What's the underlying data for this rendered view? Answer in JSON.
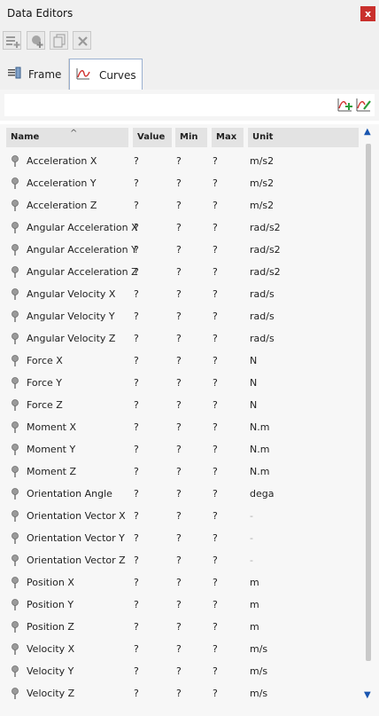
{
  "window": {
    "title": "Data Editors",
    "close_label": "x"
  },
  "tabs": [
    {
      "label": "Frame",
      "icon": "frame-icon",
      "active": false
    },
    {
      "label": "Curves",
      "icon": "curves-icon",
      "active": true
    }
  ],
  "table": {
    "columns": [
      "Name",
      "Value",
      "Min",
      "Max",
      "Unit"
    ],
    "rows": [
      {
        "name": "Acceleration X",
        "value": "?",
        "min": "?",
        "max": "?",
        "unit": "m/s2"
      },
      {
        "name": "Acceleration Y",
        "value": "?",
        "min": "?",
        "max": "?",
        "unit": "m/s2"
      },
      {
        "name": "Acceleration Z",
        "value": "?",
        "min": "?",
        "max": "?",
        "unit": "m/s2"
      },
      {
        "name": "Angular Acceleration X",
        "value": "?",
        "min": "?",
        "max": "?",
        "unit": "rad/s2"
      },
      {
        "name": "Angular Acceleration Y",
        "value": "?",
        "min": "?",
        "max": "?",
        "unit": "rad/s2"
      },
      {
        "name": "Angular Acceleration Z",
        "value": "?",
        "min": "?",
        "max": "?",
        "unit": "rad/s2"
      },
      {
        "name": "Angular Velocity X",
        "value": "?",
        "min": "?",
        "max": "?",
        "unit": "rad/s"
      },
      {
        "name": "Angular Velocity Y",
        "value": "?",
        "min": "?",
        "max": "?",
        "unit": "rad/s"
      },
      {
        "name": "Angular Velocity Z",
        "value": "?",
        "min": "?",
        "max": "?",
        "unit": "rad/s"
      },
      {
        "name": "Force X",
        "value": "?",
        "min": "?",
        "max": "?",
        "unit": "N"
      },
      {
        "name": "Force Y",
        "value": "?",
        "min": "?",
        "max": "?",
        "unit": "N"
      },
      {
        "name": "Force Z",
        "value": "?",
        "min": "?",
        "max": "?",
        "unit": "N"
      },
      {
        "name": "Moment X",
        "value": "?",
        "min": "?",
        "max": "?",
        "unit": "N.m"
      },
      {
        "name": "Moment Y",
        "value": "?",
        "min": "?",
        "max": "?",
        "unit": "N.m"
      },
      {
        "name": "Moment Z",
        "value": "?",
        "min": "?",
        "max": "?",
        "unit": "N.m"
      },
      {
        "name": "Orientation Angle",
        "value": "?",
        "min": "?",
        "max": "?",
        "unit": "dega"
      },
      {
        "name": "Orientation Vector X",
        "value": "?",
        "min": "?",
        "max": "?",
        "unit": "-"
      },
      {
        "name": "Orientation Vector Y",
        "value": "?",
        "min": "?",
        "max": "?",
        "unit": "-"
      },
      {
        "name": "Orientation Vector Z",
        "value": "?",
        "min": "?",
        "max": "?",
        "unit": "-"
      },
      {
        "name": "Position X",
        "value": "?",
        "min": "?",
        "max": "?",
        "unit": "m"
      },
      {
        "name": "Position Y",
        "value": "?",
        "min": "?",
        "max": "?",
        "unit": "m"
      },
      {
        "name": "Position Z",
        "value": "?",
        "min": "?",
        "max": "?",
        "unit": "m"
      },
      {
        "name": "Velocity X",
        "value": "?",
        "min": "?",
        "max": "?",
        "unit": "m/s"
      },
      {
        "name": "Velocity Y",
        "value": "?",
        "min": "?",
        "max": "?",
        "unit": "m/s"
      },
      {
        "name": "Velocity Z",
        "value": "?",
        "min": "?",
        "max": "?",
        "unit": "m/s"
      }
    ]
  },
  "colors": {
    "accent": "#1a56b0",
    "close": "#c9302c",
    "curve_red": "#d0312d",
    "add_green": "#2a9d3a"
  }
}
